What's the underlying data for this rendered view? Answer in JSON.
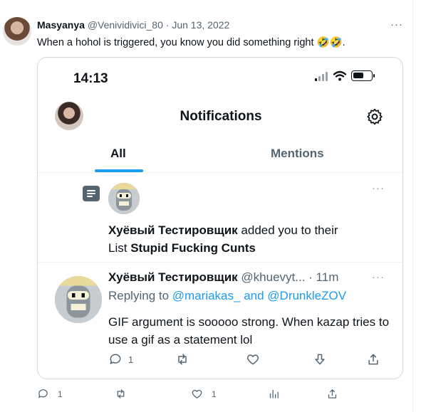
{
  "tweet": {
    "author_name": "Masyanya",
    "author_handle": "@Venividivici_80",
    "separator": " · ",
    "date": "Jun 13, 2022",
    "more": "···",
    "text": "When a hohol is triggered, you know you did something right 🤣🤣."
  },
  "screenshot": {
    "status_time": "14:13",
    "title": "Notifications",
    "tabs": [
      {
        "label": "All",
        "active": true
      },
      {
        "label": "Mentions",
        "active": false
      }
    ],
    "notification": {
      "actor": "Хуёвый Тестировщик",
      "action_line1": " added you to their",
      "action_line2_prefix": "List ",
      "list_name": "Stupid Fucking Cunts",
      "more": "···"
    },
    "reply_tweet": {
      "author_name": "Хуёвый Тестировщик",
      "author_handle": "@khuevyt...",
      "separator": " · ",
      "time": "11m",
      "more": "···",
      "replying_to_label": "Replying to ",
      "mention_1": "@mariakas_",
      "and_label": " and ",
      "mention_2": "@DrunkleZOV",
      "text": "GIF argument is sooooo strong. When kazap tries to use a gif as a statement lol",
      "reply_count": "1",
      "retweet_count": "",
      "like_count": ""
    }
  },
  "bottom_actions": {
    "reply_count": "1",
    "retweet_count": "",
    "like_count": "1"
  },
  "colors": {
    "accent": "#1d9bf0",
    "muted": "#536471",
    "text": "#0f1419",
    "border": "#cfd9de"
  }
}
